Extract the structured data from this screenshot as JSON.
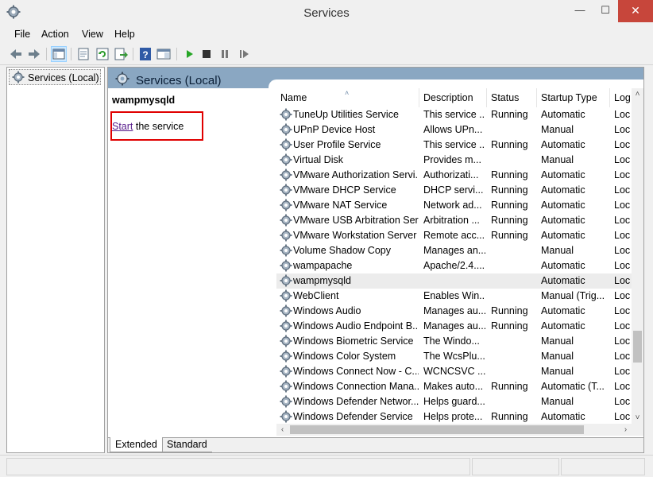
{
  "window": {
    "title": "Services",
    "minimize": "—",
    "maximize": "☐",
    "close": "✕"
  },
  "menu": [
    "File",
    "Action",
    "View",
    "Help"
  ],
  "toolbar": [
    "back-icon",
    "forward-icon",
    "console-tree-icon",
    "properties-icon",
    "refresh-icon",
    "export-list-icon",
    "help-icon",
    "show-hide-icon",
    "start-icon",
    "stop-icon",
    "pause-icon",
    "restart-icon"
  ],
  "tree": {
    "label": "Services (Local)"
  },
  "pane": {
    "title": "Services (Local)"
  },
  "detail": {
    "service_name": "wampmysqld",
    "start_link": "Start",
    "start_suffix": " the service"
  },
  "columns": {
    "sort_caret": "˄",
    "name": "Name",
    "description": "Description",
    "status": "Status",
    "startup": "Startup Type",
    "log": "Log"
  },
  "services": [
    {
      "name": "TuneUp Utilities Service",
      "description": "This service ...",
      "status": "Running",
      "startup": "Automatic",
      "log": "Loc"
    },
    {
      "name": "UPnP Device Host",
      "description": "Allows UPn...",
      "status": "",
      "startup": "Manual",
      "log": "Loc"
    },
    {
      "name": "User Profile Service",
      "description": "This service ...",
      "status": "Running",
      "startup": "Automatic",
      "log": "Loc"
    },
    {
      "name": "Virtual Disk",
      "description": "Provides m...",
      "status": "",
      "startup": "Manual",
      "log": "Loc"
    },
    {
      "name": "VMware Authorization Servi...",
      "description": "Authorizati...",
      "status": "Running",
      "startup": "Automatic",
      "log": "Loc"
    },
    {
      "name": "VMware DHCP Service",
      "description": "DHCP servi...",
      "status": "Running",
      "startup": "Automatic",
      "log": "Loc"
    },
    {
      "name": "VMware NAT Service",
      "description": "Network ad...",
      "status": "Running",
      "startup": "Automatic",
      "log": "Loc"
    },
    {
      "name": "VMware USB Arbitration Ser...",
      "description": "Arbitration ...",
      "status": "Running",
      "startup": "Automatic",
      "log": "Loc"
    },
    {
      "name": "VMware Workstation Server",
      "description": "Remote acc...",
      "status": "Running",
      "startup": "Automatic",
      "log": "Loc"
    },
    {
      "name": "Volume Shadow Copy",
      "description": "Manages an...",
      "status": "",
      "startup": "Manual",
      "log": "Loc"
    },
    {
      "name": "wampapache",
      "description": "Apache/2.4....",
      "status": "",
      "startup": "Automatic",
      "log": "Loc"
    },
    {
      "name": "wampmysqld",
      "description": "",
      "status": "",
      "startup": "Automatic",
      "log": "Loc",
      "selected": true
    },
    {
      "name": "WebClient",
      "description": "Enables Win...",
      "status": "",
      "startup": "Manual (Trig...",
      "log": "Loc"
    },
    {
      "name": "Windows Audio",
      "description": "Manages au...",
      "status": "Running",
      "startup": "Automatic",
      "log": "Loc"
    },
    {
      "name": "Windows Audio Endpoint B...",
      "description": "Manages au...",
      "status": "Running",
      "startup": "Automatic",
      "log": "Loc"
    },
    {
      "name": "Windows Biometric Service",
      "description": "The Windo...",
      "status": "",
      "startup": "Manual",
      "log": "Loc"
    },
    {
      "name": "Windows Color System",
      "description": "The WcsPlu...",
      "status": "",
      "startup": "Manual",
      "log": "Loc"
    },
    {
      "name": "Windows Connect Now - C...",
      "description": "WCNCSVC ...",
      "status": "",
      "startup": "Manual",
      "log": "Loc"
    },
    {
      "name": "Windows Connection Mana...",
      "description": "Makes auto...",
      "status": "Running",
      "startup": "Automatic (T...",
      "log": "Loc"
    },
    {
      "name": "Windows Defender Networ...",
      "description": "Helps guard...",
      "status": "",
      "startup": "Manual",
      "log": "Loc"
    },
    {
      "name": "Windows Defender Service",
      "description": "Helps prote...",
      "status": "Running",
      "startup": "Automatic",
      "log": "Loc"
    }
  ],
  "tabs": {
    "extended": "Extended",
    "standard": "Standard"
  },
  "scroll": {
    "up": "˄",
    "down": "˅",
    "left": "‹",
    "right": "›"
  },
  "colors": {
    "header_band": "#8aa7c2",
    "highlight_box": "#e00000",
    "link": "#551a8b",
    "close_button": "#c7463b"
  }
}
